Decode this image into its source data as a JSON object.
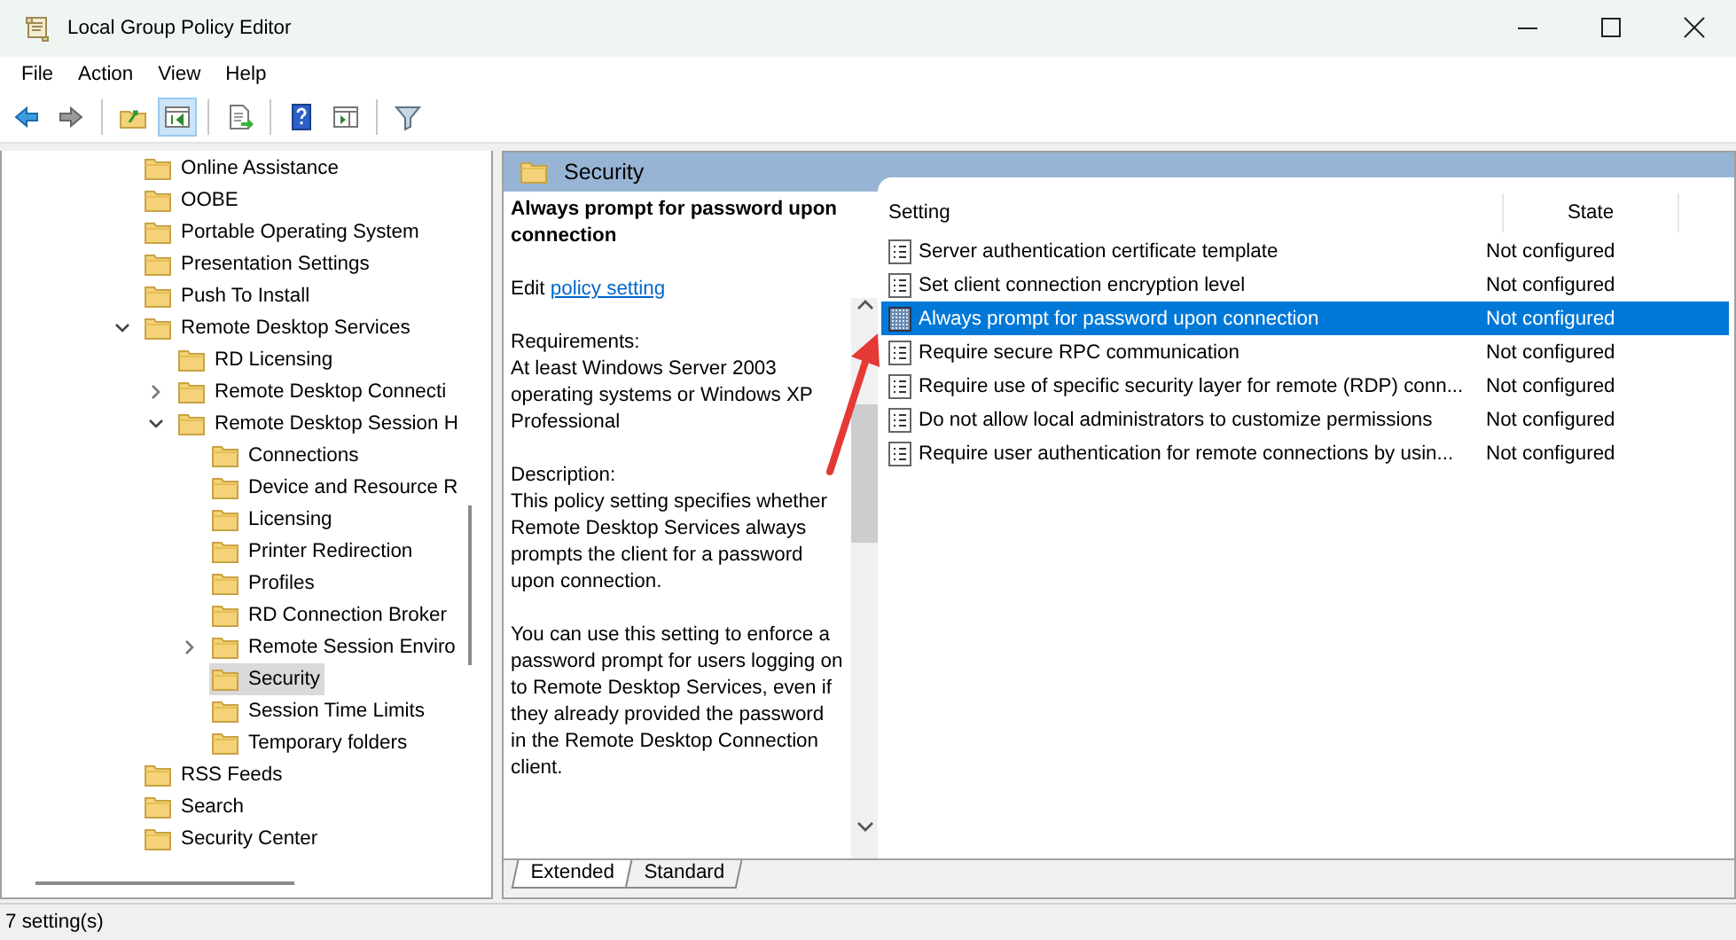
{
  "window": {
    "title": "Local Group Policy Editor"
  },
  "menu": [
    "File",
    "Action",
    "View",
    "Help"
  ],
  "toolbar": [
    {
      "kind": "back",
      "pressed": false
    },
    {
      "kind": "forward",
      "pressed": false
    },
    {
      "kind": "sep"
    },
    {
      "kind": "up",
      "pressed": false
    },
    {
      "kind": "tree",
      "pressed": true
    },
    {
      "kind": "sep"
    },
    {
      "kind": "export",
      "pressed": false
    },
    {
      "kind": "sep"
    },
    {
      "kind": "help",
      "pressed": false
    },
    {
      "kind": "pane",
      "pressed": false
    },
    {
      "kind": "sep"
    },
    {
      "kind": "filter",
      "pressed": false
    }
  ],
  "tree": [
    {
      "label": "Online Assistance",
      "selected": false
    },
    {
      "label": "OOBE",
      "selected": false
    },
    {
      "label": "Portable Operating System",
      "selected": false
    },
    {
      "label": "Presentation Settings",
      "selected": false
    },
    {
      "label": "Push To Install",
      "selected": false
    },
    {
      "label": "Remote Desktop Services",
      "selected": false,
      "expanded": true,
      "children": [
        {
          "label": "RD Licensing",
          "selected": false
        },
        {
          "label": "Remote Desktop Connecti",
          "selected": false,
          "expanded": false
        },
        {
          "label": "Remote Desktop Session H",
          "selected": false,
          "expanded": true,
          "children": [
            {
              "label": "Connections",
              "selected": false
            },
            {
              "label": "Device and Resource R",
              "selected": false
            },
            {
              "label": "Licensing",
              "selected": false
            },
            {
              "label": "Printer Redirection",
              "selected": false
            },
            {
              "label": "Profiles",
              "selected": false
            },
            {
              "label": "RD Connection Broker",
              "selected": false
            },
            {
              "label": "Remote Session Enviro",
              "selected": false,
              "expanded": false
            },
            {
              "label": "Security",
              "selected": true
            },
            {
              "label": "Session Time Limits",
              "selected": false
            },
            {
              "label": "Temporary folders",
              "selected": false
            }
          ]
        }
      ]
    },
    {
      "label": "RSS Feeds",
      "selected": false
    },
    {
      "label": "Search",
      "selected": false
    },
    {
      "label": "Security Center",
      "selected": false
    }
  ],
  "details": {
    "header": "Security",
    "description": {
      "title": "Always prompt for password upon connection",
      "edit_prefix": "Edit",
      "edit_link": "policy setting",
      "paragraphs": [
        "Requirements:\nAt least Windows Server 2003 operating systems or Windows XP Professional",
        "Description:\nThis policy setting specifies whether Remote Desktop Services always prompts the client for a password upon connection.",
        "You can use this setting to enforce a password prompt for users logging on to Remote Desktop Services, even if they already provided the password in the Remote Desktop Connection client."
      ]
    },
    "columns": [
      "Setting",
      "State"
    ],
    "rows": [
      {
        "setting": "Server authentication certificate template",
        "state": "Not configured",
        "selected": false
      },
      {
        "setting": "Set client connection encryption level",
        "state": "Not configured",
        "selected": false
      },
      {
        "setting": "Always prompt for password upon connection",
        "state": "Not configured",
        "selected": true
      },
      {
        "setting": "Require secure RPC communication",
        "state": "Not configured",
        "selected": false
      },
      {
        "setting": "Require use of specific security layer for remote (RDP) conn...",
        "state": "Not configured",
        "selected": false
      },
      {
        "setting": "Do not allow local administrators to customize permissions",
        "state": "Not configured",
        "selected": false
      },
      {
        "setting": "Require user authentication for remote connections by usin...",
        "state": "Not configured",
        "selected": false
      }
    ],
    "tabs": [
      {
        "label": "Extended",
        "selected": true
      },
      {
        "label": "Standard",
        "selected": false
      }
    ]
  },
  "status_bar": "7 setting(s)"
}
